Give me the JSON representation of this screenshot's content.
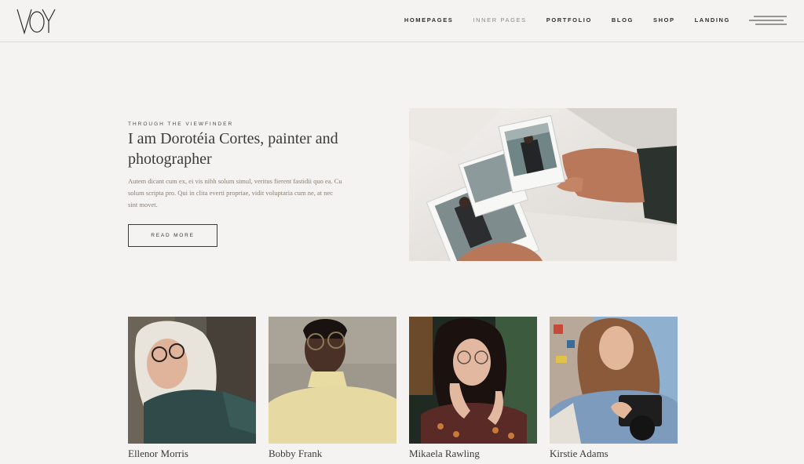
{
  "header": {
    "logo_text": "VOY",
    "nav": [
      {
        "label": "Homepages",
        "active": true
      },
      {
        "label": "Inner Pages",
        "active": false
      },
      {
        "label": "Portfolio",
        "active": true
      },
      {
        "label": "Blog",
        "active": true
      },
      {
        "label": "Shop",
        "active": true
      },
      {
        "label": "Landing",
        "active": true
      }
    ],
    "menu_icon": "hamburger-lines-icon"
  },
  "hero": {
    "eyebrow": "Through the viewfinder",
    "title": "I am Dorotéia Cortes, painter and photographer",
    "text": "Autem dicant cum ex, ei vis nibh solum simul, veritus fierent fastidii quo ea. Cu solum scripta pro. Qui in clita everti propriae, vidit voluptaria cum ne, at nec sint movet.",
    "button": "Read more",
    "image": "hand-holding-polaroid-photos"
  },
  "team": [
    {
      "name": "Ellenor Morris",
      "image": "blonde-woman-glasses-denim-jacket"
    },
    {
      "name": "Bobby Frank",
      "image": "man-glasses-yellow-turtleneck"
    },
    {
      "name": "Mikaela Rawling",
      "image": "woman-glasses-hands-raised"
    },
    {
      "name": "Kirstie Adams",
      "image": "woman-holding-camera"
    }
  ],
  "colors": {
    "background": "#f4f3f1",
    "text": "#3a3a3a",
    "muted_text": "#8a7d73",
    "divider": "#dcdcdc"
  }
}
